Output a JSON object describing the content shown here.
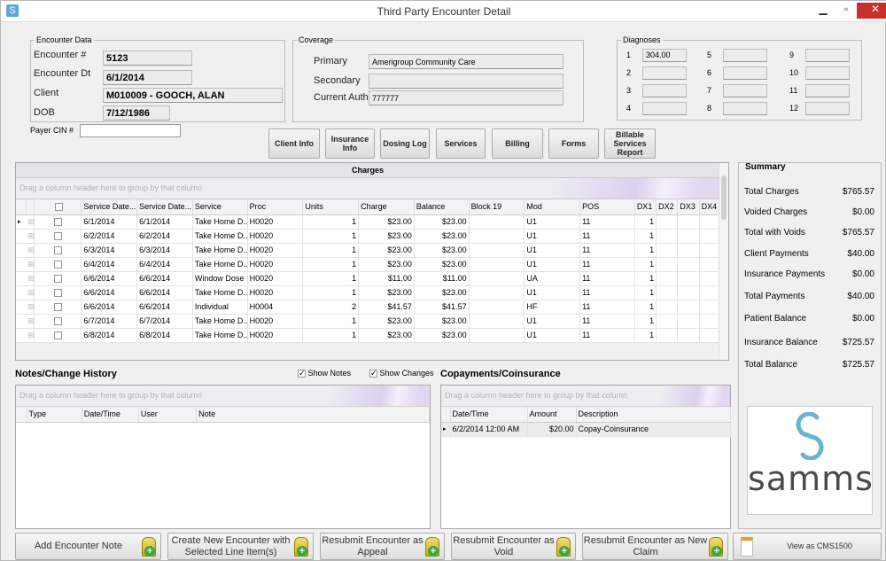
{
  "window": {
    "title": "Third Party Encounter Detail",
    "minimize": "▁",
    "maximize": "▫",
    "close": "✕"
  },
  "encounter": {
    "legend": "Encounter Data",
    "number_label": "Encounter #",
    "number": "5123",
    "date_label": "Encounter Dt",
    "date": "6/1/2014",
    "client_label": "Client",
    "client": "M010009 - GOOCH, ALAN",
    "dob_label": "DOB",
    "dob": "7/12/1986",
    "payer_cin_label": "Payer CIN #",
    "payer_cin": ""
  },
  "coverage": {
    "legend": "Coverage",
    "primary_label": "Primary",
    "primary": "Amerigroup Community Care",
    "secondary_label": "Secondary",
    "secondary": "",
    "auth_label": "Current Auth",
    "auth": "777777"
  },
  "diagnoses": {
    "legend": "Diagnoses",
    "items": [
      {
        "n": "1",
        "v": "304.00"
      },
      {
        "n": "2",
        "v": ""
      },
      {
        "n": "3",
        "v": ""
      },
      {
        "n": "4",
        "v": ""
      },
      {
        "n": "5",
        "v": ""
      },
      {
        "n": "6",
        "v": ""
      },
      {
        "n": "7",
        "v": ""
      },
      {
        "n": "8",
        "v": ""
      },
      {
        "n": "9",
        "v": ""
      },
      {
        "n": "10",
        "v": ""
      },
      {
        "n": "11",
        "v": ""
      },
      {
        "n": "12",
        "v": ""
      }
    ]
  },
  "nav": [
    "Client Info",
    "Insurance Info",
    "Dosing Log",
    "Services",
    "Billing",
    "Forms",
    "Billable Services Report"
  ],
  "charges": {
    "title": "Charges",
    "group_hint": "Drag a column header here to group by that column",
    "columns": [
      "",
      "",
      "Service Date...",
      "Service Date...",
      "Service",
      "Proc",
      "Units",
      "Charge",
      "Balance",
      "Block 19",
      "Mod",
      "POS",
      "DX1",
      "DX2",
      "DX3",
      "DX4"
    ],
    "rows": [
      [
        "6/1/2014",
        "6/1/2014",
        "Take Home D...",
        "H0020",
        "1",
        "$23.00",
        "$23.00",
        "",
        "U1",
        "11",
        "1",
        "",
        "",
        ""
      ],
      [
        "6/2/2014",
        "6/2/2014",
        "Take Home D...",
        "H0020",
        "1",
        "$23.00",
        "$23.00",
        "",
        "U1",
        "11",
        "1",
        "",
        "",
        ""
      ],
      [
        "6/3/2014",
        "6/3/2014",
        "Take Home D...",
        "H0020",
        "1",
        "$23.00",
        "$23.00",
        "",
        "U1",
        "11",
        "1",
        "",
        "",
        ""
      ],
      [
        "6/4/2014",
        "6/4/2014",
        "Take Home D...",
        "H0020",
        "1",
        "$23.00",
        "$23.00",
        "",
        "U1",
        "11",
        "1",
        "",
        "",
        ""
      ],
      [
        "6/6/2014",
        "6/6/2014",
        "Window Dose",
        "H0020",
        "1",
        "$11.00",
        "$11.00",
        "",
        "UA",
        "11",
        "1",
        "",
        "",
        ""
      ],
      [
        "6/6/2014",
        "6/6/2014",
        "Take Home D...",
        "H0020",
        "1",
        "$23.00",
        "$23.00",
        "",
        "U1",
        "11",
        "1",
        "",
        "",
        ""
      ],
      [
        "6/6/2014",
        "6/6/2014",
        "Individual",
        "H0004",
        "2",
        "$41.57",
        "$41.57",
        "",
        "HF",
        "11",
        "1",
        "",
        "",
        ""
      ],
      [
        "6/7/2014",
        "6/7/2014",
        "Take Home D...",
        "H0020",
        "1",
        "$23.00",
        "$23.00",
        "",
        "U1",
        "11",
        "1",
        "",
        "",
        ""
      ],
      [
        "6/8/2014",
        "6/8/2014",
        "Take Home D...",
        "H0020",
        "1",
        "$23.00",
        "$23.00",
        "",
        "U1",
        "11",
        "1",
        "",
        "",
        ""
      ]
    ]
  },
  "summary": {
    "title": "Summary",
    "items": [
      {
        "label": "Total Charges",
        "value": "$765.57"
      },
      {
        "label": "Voided Charges",
        "value": "$0.00"
      },
      {
        "label": "Total with Voids",
        "value": "$765.57"
      },
      {
        "label": "Client Payments",
        "value": "$40.00"
      },
      {
        "label": "Insurance Payments",
        "value": "$0.00"
      },
      {
        "label": "Total Payments",
        "value": "$40.00"
      },
      {
        "label": "Patient Balance",
        "value": "$0.00"
      },
      {
        "label": "Insurance Balance",
        "value": "$725.57"
      },
      {
        "label": "Total Balance",
        "value": "$725.57"
      }
    ],
    "logo_text": "samms",
    "logo_color": "#6bb3d0"
  },
  "notes": {
    "title": "Notes/Change History",
    "show_notes": "Show Notes",
    "show_changes": "Show Changes",
    "group_hint": "Drag a column header here to group by that column",
    "columns": [
      "Type",
      "Date/Time",
      "User",
      "Note"
    ]
  },
  "copay": {
    "title": "Copayments/Coinsurance",
    "group_hint": "Drag a column header here to group by that column",
    "columns": [
      "Date/Time",
      "Amount",
      "Description"
    ],
    "rows": [
      [
        "6/2/2014 12:00 AM",
        "$20.00",
        "Copay-Coinsurance"
      ]
    ]
  },
  "actions": [
    "Add Encounter Note",
    "Create New Encounter with Selected Line Item(s)",
    "Resubmit Encounter as Appeal",
    "Resubmit Encounter as Void",
    "Resubmit Encounter as New Claim",
    "View as CMS1500"
  ]
}
